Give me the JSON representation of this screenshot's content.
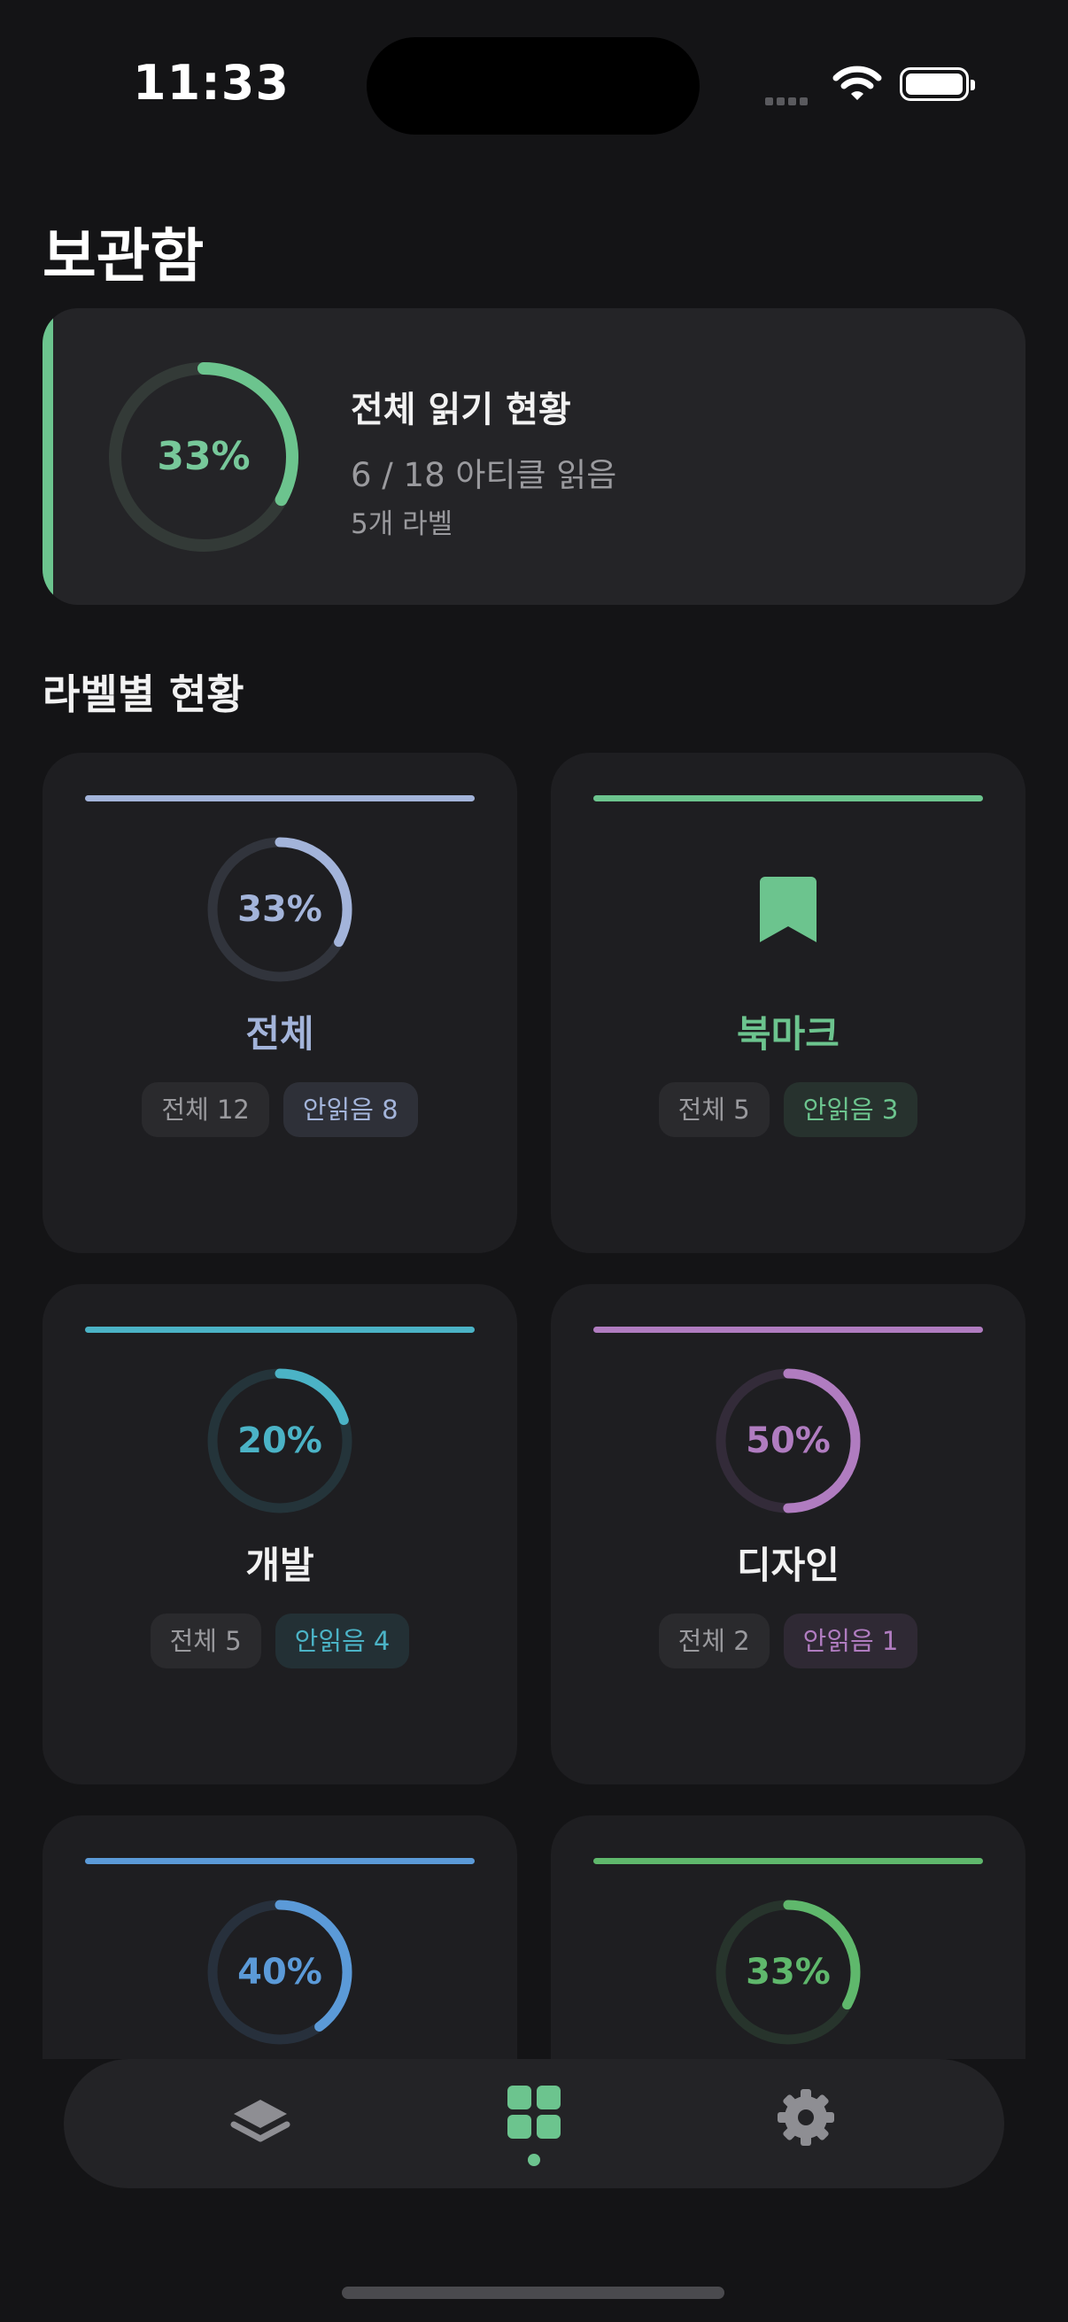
{
  "status_bar": {
    "time": "11:33"
  },
  "header": {
    "title": "보관함"
  },
  "summary": {
    "percent_label": "33%",
    "progress": 0.33,
    "title": "전체 읽기 현황",
    "count_text": "6 / 18 아티클 읽음",
    "labels_text": "5개 라벨",
    "accent_color": "#6cc48e"
  },
  "section": {
    "title": "라벨별 현황"
  },
  "labels": [
    {
      "name": "전체",
      "percent_label": "33%",
      "progress": 0.33,
      "color": "#a3b4da",
      "total": "전체 12",
      "unread": "안읽음 8",
      "icon": null
    },
    {
      "name": "북마크",
      "percent_label": "",
      "progress": null,
      "color": "#6cc48e",
      "total": "전체 5",
      "unread": "안읽음 3",
      "icon": "bookmark-icon"
    },
    {
      "name": "개발",
      "percent_label": "20%",
      "progress": 0.2,
      "color": "#4bb3c6",
      "total": "전체 5",
      "unread": "안읽음 4",
      "icon": null
    },
    {
      "name": "디자인",
      "percent_label": "50%",
      "progress": 0.5,
      "color": "#b07cc0",
      "total": "전체 2",
      "unread": "안읽음 1",
      "icon": null
    },
    {
      "name": "",
      "percent_label": "40%",
      "progress": 0.4,
      "color": "#5b9ad8",
      "total": "",
      "unread": "",
      "icon": null
    },
    {
      "name": "",
      "percent_label": "33%",
      "progress": 0.33,
      "color": "#5fb86c",
      "total": "",
      "unread": "",
      "icon": null
    }
  ],
  "tab_bar": {
    "tabs": [
      {
        "icon": "layers-icon",
        "active": false
      },
      {
        "icon": "grid-icon",
        "active": true
      },
      {
        "icon": "gear-icon",
        "active": false
      }
    ],
    "active_color": "#6cc48e",
    "inactive_color": "#8e8e93"
  }
}
